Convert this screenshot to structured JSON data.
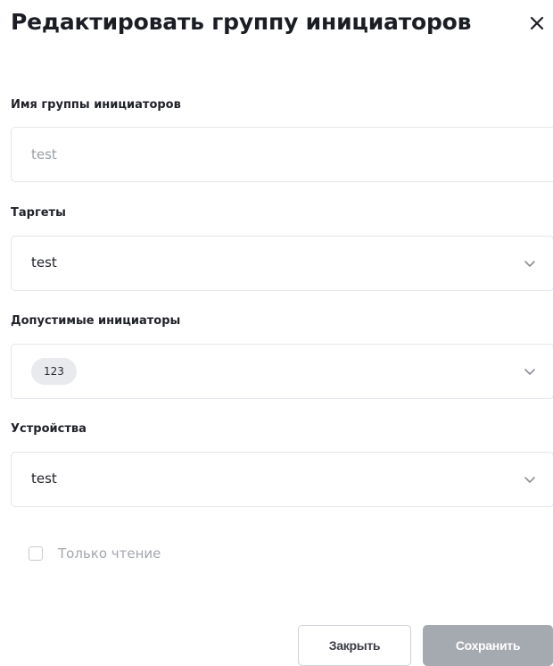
{
  "dialog": {
    "title": "Редактировать группу инициаторов"
  },
  "fields": {
    "group_name": {
      "label": "Имя группы инициаторов",
      "value": "test"
    },
    "targets": {
      "label": "Таргеты",
      "value": "test"
    },
    "allowed_initiators": {
      "label": "Допустимые инициаторы",
      "chips": [
        "123"
      ]
    },
    "devices": {
      "label": "Устройства",
      "value": "test"
    }
  },
  "read_only": {
    "label": "Только чтение",
    "checked": false
  },
  "footer": {
    "close_label": "Закрыть",
    "save_label": "Сохранить"
  }
}
